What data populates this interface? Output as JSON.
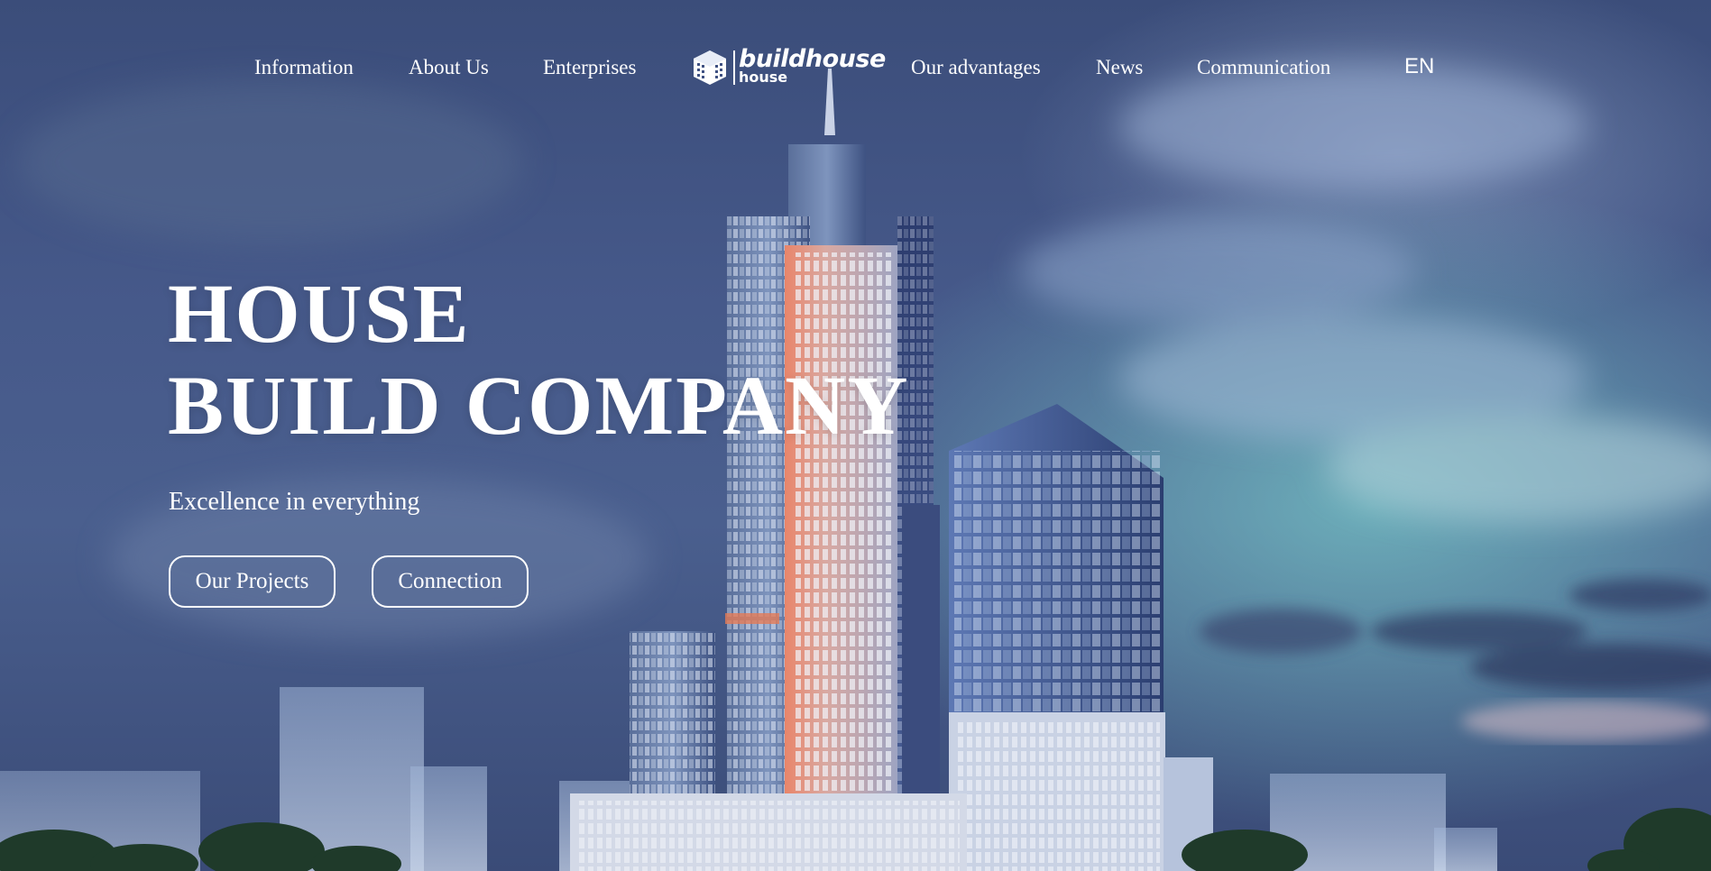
{
  "nav": {
    "left_items": [
      {
        "label": "Information"
      },
      {
        "label": "About Us"
      },
      {
        "label": "Enterprises"
      }
    ],
    "right_items": [
      {
        "label": "Our advantages"
      },
      {
        "label": "News"
      },
      {
        "label": "Communication"
      }
    ],
    "language": "EN"
  },
  "logo": {
    "wordmark": "buildhouse",
    "subtext": "house",
    "icon": "building-cube-icon"
  },
  "hero": {
    "title_line1": "HOUSE",
    "title_line2": "BUILD COMPANY",
    "tagline": "Excellence in everything",
    "buttons": {
      "projects": "Our Projects",
      "connection": "Connection"
    }
  },
  "colors": {
    "sky_top": "#3b4d7a",
    "sky_glow": "#78c8c8",
    "text": "#ffffff",
    "tower_accent": "#e07a4f"
  }
}
